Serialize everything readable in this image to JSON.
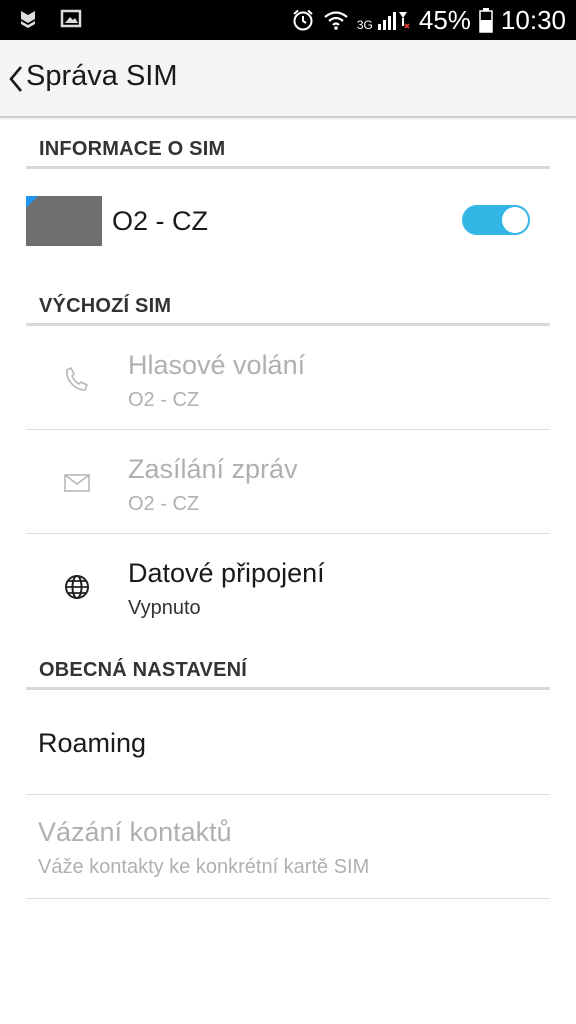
{
  "status_bar": {
    "battery_percent": "45%",
    "time": "10:30",
    "network_type": "3G",
    "icons": [
      "shield-icon",
      "image-icon",
      "alarm-icon",
      "wifi-icon",
      "signal-icon",
      "battery-icon"
    ]
  },
  "header": {
    "title": "Správa SIM"
  },
  "sections": {
    "sim_info": {
      "header": "INFORMACE O SIM",
      "sim_name": "O2 - CZ",
      "toggle_on": true
    },
    "default_sim": {
      "header": "VÝCHOZÍ SIM",
      "items": [
        {
          "title": "Hlasové volání",
          "summary": "O2 - CZ",
          "icon": "phone-icon",
          "enabled": false
        },
        {
          "title": "Zasílání zpráv",
          "summary": "O2 - CZ",
          "icon": "envelope-icon",
          "enabled": false
        },
        {
          "title": "Datové připojení",
          "summary": "Vypnuto",
          "icon": "globe-icon",
          "enabled": true
        }
      ]
    },
    "general": {
      "header": "OBECNÁ NASTAVENÍ",
      "items": [
        {
          "title": "Roaming",
          "summary": "",
          "enabled": true
        },
        {
          "title": "Vázání kontaktů",
          "summary": "Váže kontakty ke konkrétní kartě SIM",
          "enabled": false
        }
      ]
    }
  },
  "colors": {
    "accent": "#33b5e5",
    "sim_corner": "#2196f3",
    "disabled_text": "#b0b0b0",
    "status_bar": "#000000",
    "action_bar": "#f5f5f5"
  }
}
